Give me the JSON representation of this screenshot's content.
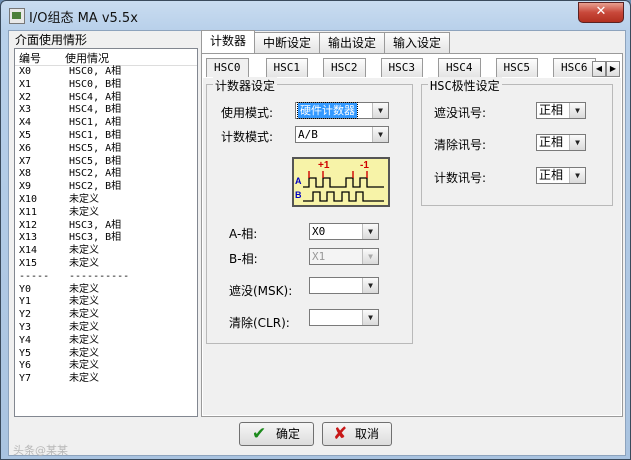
{
  "window": {
    "title": "I/O组态 MA v5.5x",
    "close_glyph": "✕"
  },
  "left_panel": {
    "title": "介面使用情形",
    "col_headers": [
      "编号",
      "使用情况"
    ],
    "rows": [
      [
        "X0",
        "HSC0, A相"
      ],
      [
        "X1",
        "HSC0, B相"
      ],
      [
        "X2",
        "HSC4, A相"
      ],
      [
        "X3",
        "HSC4, B相"
      ],
      [
        "X4",
        "HSC1, A相"
      ],
      [
        "X5",
        "HSC1, B相"
      ],
      [
        "X6",
        "HSC5, A相"
      ],
      [
        "X7",
        "HSC5, B相"
      ],
      [
        "X8",
        "HSC2, A相"
      ],
      [
        "X9",
        "HSC2, B相"
      ],
      [
        "X10",
        "未定义"
      ],
      [
        "X11",
        "未定义"
      ],
      [
        "X12",
        "HSC3, A相"
      ],
      [
        "X13",
        "HSC3, B相"
      ],
      [
        "X14",
        "未定义"
      ],
      [
        "X15",
        "未定义"
      ],
      [
        "-----",
        "----------"
      ],
      [
        "Y0",
        "未定义"
      ],
      [
        "Y1",
        "未定义"
      ],
      [
        "Y2",
        "未定义"
      ],
      [
        "Y3",
        "未定义"
      ],
      [
        "Y4",
        "未定义"
      ],
      [
        "Y5",
        "未定义"
      ],
      [
        "Y6",
        "未定义"
      ],
      [
        "Y7",
        "未定义"
      ]
    ]
  },
  "tabs": [
    "计数器",
    "中断设定",
    "输出设定",
    "输入设定"
  ],
  "subtabs": [
    "HSC0",
    "HSC1",
    "HSC2",
    "HSC3",
    "HSC4",
    "HSC5",
    "HSC6"
  ],
  "spin": {
    "left": "◀",
    "right": "▶"
  },
  "counter_settings": {
    "title": "计数器设定",
    "use_mode_label": "使用模式:",
    "use_mode_value": "硬件计数器",
    "count_mode_label": "计数模式:",
    "count_mode_value": "A/B",
    "diagram": {
      "plus": "+1",
      "minus": "-1",
      "a": "A",
      "b": "B"
    },
    "a_phase_label": "A-相:",
    "a_phase_value": "X0",
    "b_phase_label": "B-相:",
    "b_phase_value": "X1",
    "mask_label": "遮没(MSK):",
    "mask_value": "",
    "clear_label": "清除(CLR):",
    "clear_value": ""
  },
  "polarity": {
    "title": "HSC极性设定",
    "mask_label": "遮没讯号:",
    "mask_value": "正相",
    "clear_label": "清除讯号:",
    "clear_value": "正相",
    "count_label": "计数讯号:",
    "count_value": "正相"
  },
  "buttons": {
    "ok": "确定",
    "cancel": "取消",
    "ok_icon": "✔",
    "cancel_icon": "✘"
  },
  "watermark": "头条@某某"
}
